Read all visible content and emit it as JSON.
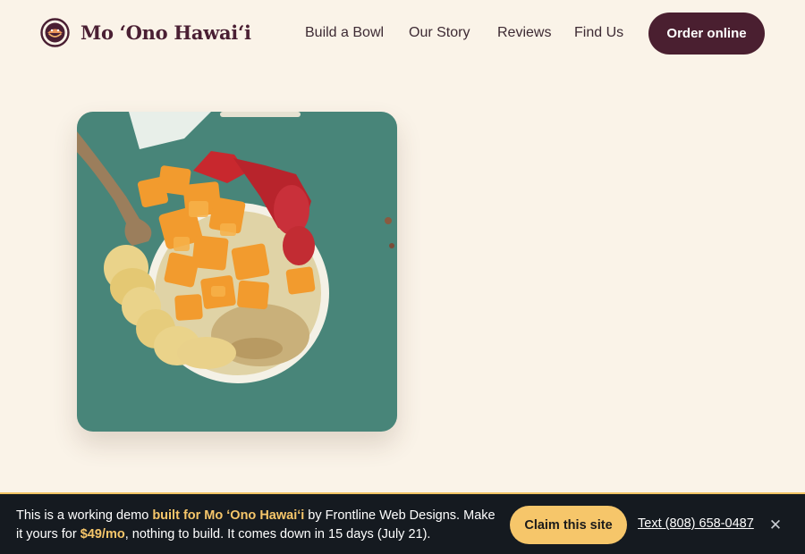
{
  "header": {
    "brand": "Mo ʻOno Hawaiʻi",
    "logo_icon": "smiling-bowl-icon",
    "nav": [
      {
        "label": "Build a Bowl"
      },
      {
        "label": "Our Story"
      },
      {
        "label": "Reviews"
      },
      {
        "label": "Find Us"
      }
    ],
    "order_button": "Order online"
  },
  "hero": {
    "image_alt": "Açaí bowl topped with mango, strawberries, banana and granola"
  },
  "banner": {
    "text_1": "This is a working demo ",
    "text_highlight_1": "built for Mo ʻOno Hawaiʻi",
    "text_2": " by Frontline Web Designs. Make it yours for ",
    "text_highlight_2": "$49/mo",
    "text_3": ", nothing to build. It comes down in 15 days (July 21).",
    "claim_button": "Claim this site",
    "text_link": "Text (808) 658-0487",
    "close_icon": "close-icon"
  },
  "colors": {
    "background": "#faf3e8",
    "brand": "#4a1f30",
    "accent": "#f6c66a",
    "banner_bg": "#151a20"
  }
}
